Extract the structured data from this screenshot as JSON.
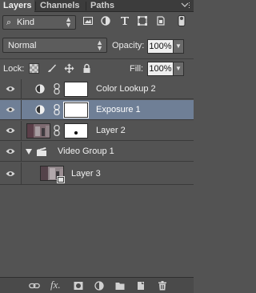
{
  "tabs": [
    {
      "label": "Layers",
      "active": true
    },
    {
      "label": "Channels",
      "active": false
    },
    {
      "label": "Paths",
      "active": false
    }
  ],
  "panel_menu_icon": "panel-menu-icon",
  "filter": {
    "kind_label": "Kind",
    "icons": [
      "image-filter-icon",
      "adjustment-filter-icon",
      "text-filter-icon",
      "shape-filter-icon",
      "smart-object-filter-icon"
    ],
    "toggle": "filter-toggle-icon"
  },
  "blend": {
    "mode": "Normal",
    "opacity_label": "Opacity:",
    "opacity_value": "100%"
  },
  "lock": {
    "label": "Lock:",
    "icons": [
      "lock-transparent-icon",
      "lock-image-icon",
      "lock-position-icon",
      "lock-all-icon"
    ],
    "fill_label": "Fill:",
    "fill_value": "100%"
  },
  "layers": [
    {
      "name": "Color Lookup 2",
      "type": "adjustment",
      "selected": false,
      "visible": true
    },
    {
      "name": "Exposure 1",
      "type": "adjustment",
      "selected": true,
      "visible": true
    },
    {
      "name": "Layer 2",
      "type": "image-with-mask",
      "selected": false,
      "visible": true
    },
    {
      "name": "Video Group 1",
      "type": "video-group",
      "selected": false,
      "visible": true
    },
    {
      "name": "Layer 3",
      "type": "image",
      "selected": false,
      "visible": true
    }
  ],
  "bottom_icons": [
    "link-layers-icon",
    "fx-icon",
    "add-mask-icon",
    "new-adjustment-icon",
    "new-group-icon",
    "new-layer-icon",
    "delete-layer-icon"
  ],
  "bottom_labels": {
    "fx": "fx."
  },
  "colors": {
    "panel_bg": "#535353",
    "selected_row": "#6f7f96",
    "tab_bar": "#3c3c3c"
  }
}
